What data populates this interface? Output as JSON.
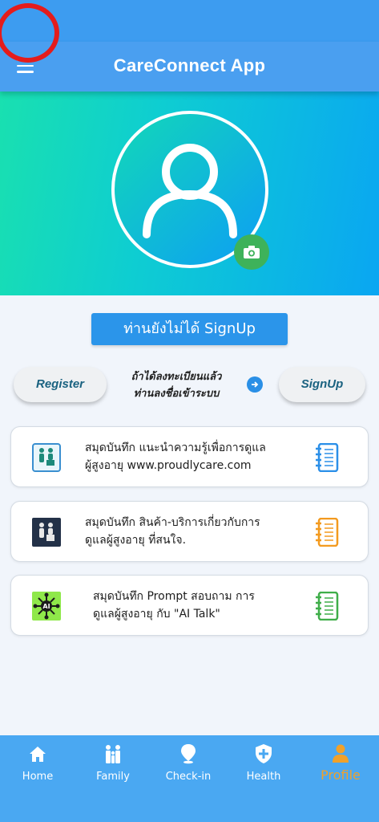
{
  "app": {
    "title": "CareConnect App"
  },
  "auth": {
    "status_badge": "ท่านยังไม่ได้ SignUp",
    "register_label": "Register",
    "signup_label": "SignUp",
    "hint_line1": "ถ้าได้ลงทะเบียนแล้ว",
    "hint_line2": "ท่านลงชื่อเข้าระบบ"
  },
  "cards": [
    {
      "line1": "สมุดบันทึก แนะนำความรู้เพื่อการดูแล",
      "line2": "ผู้สูงอายุ www.proudlycare.com",
      "icon": "elderly-care-icon",
      "notebook_color": "#2b8fe8"
    },
    {
      "line1": "สมุดบันทึก สินค้า-บริการเกี่ยวกับการ",
      "line2": "ดูแลผู้สูงอายุ ที่สนใจ.",
      "icon": "caregiver-icon",
      "notebook_color": "#f39a1f"
    },
    {
      "line1": "สมุดบันทึก Prompt สอบถาม การ",
      "line2": "ดูแลผู้สูงอายุ กับ \"AI Talk\"",
      "icon": "ai-icon",
      "notebook_color": "#3fae49"
    }
  ],
  "nav": {
    "items": [
      {
        "label": "Home",
        "icon": "home-icon"
      },
      {
        "label": "Family",
        "icon": "family-icon"
      },
      {
        "label": "Check-in",
        "icon": "location-pin-icon"
      },
      {
        "label": "Health",
        "icon": "health-shield-icon"
      },
      {
        "label": "Profile",
        "icon": "profile-icon",
        "active": true
      }
    ]
  },
  "colors": {
    "accent": "#2b95ea",
    "active_tab": "#f0a12a",
    "menu_highlight": "#e41c1c"
  }
}
